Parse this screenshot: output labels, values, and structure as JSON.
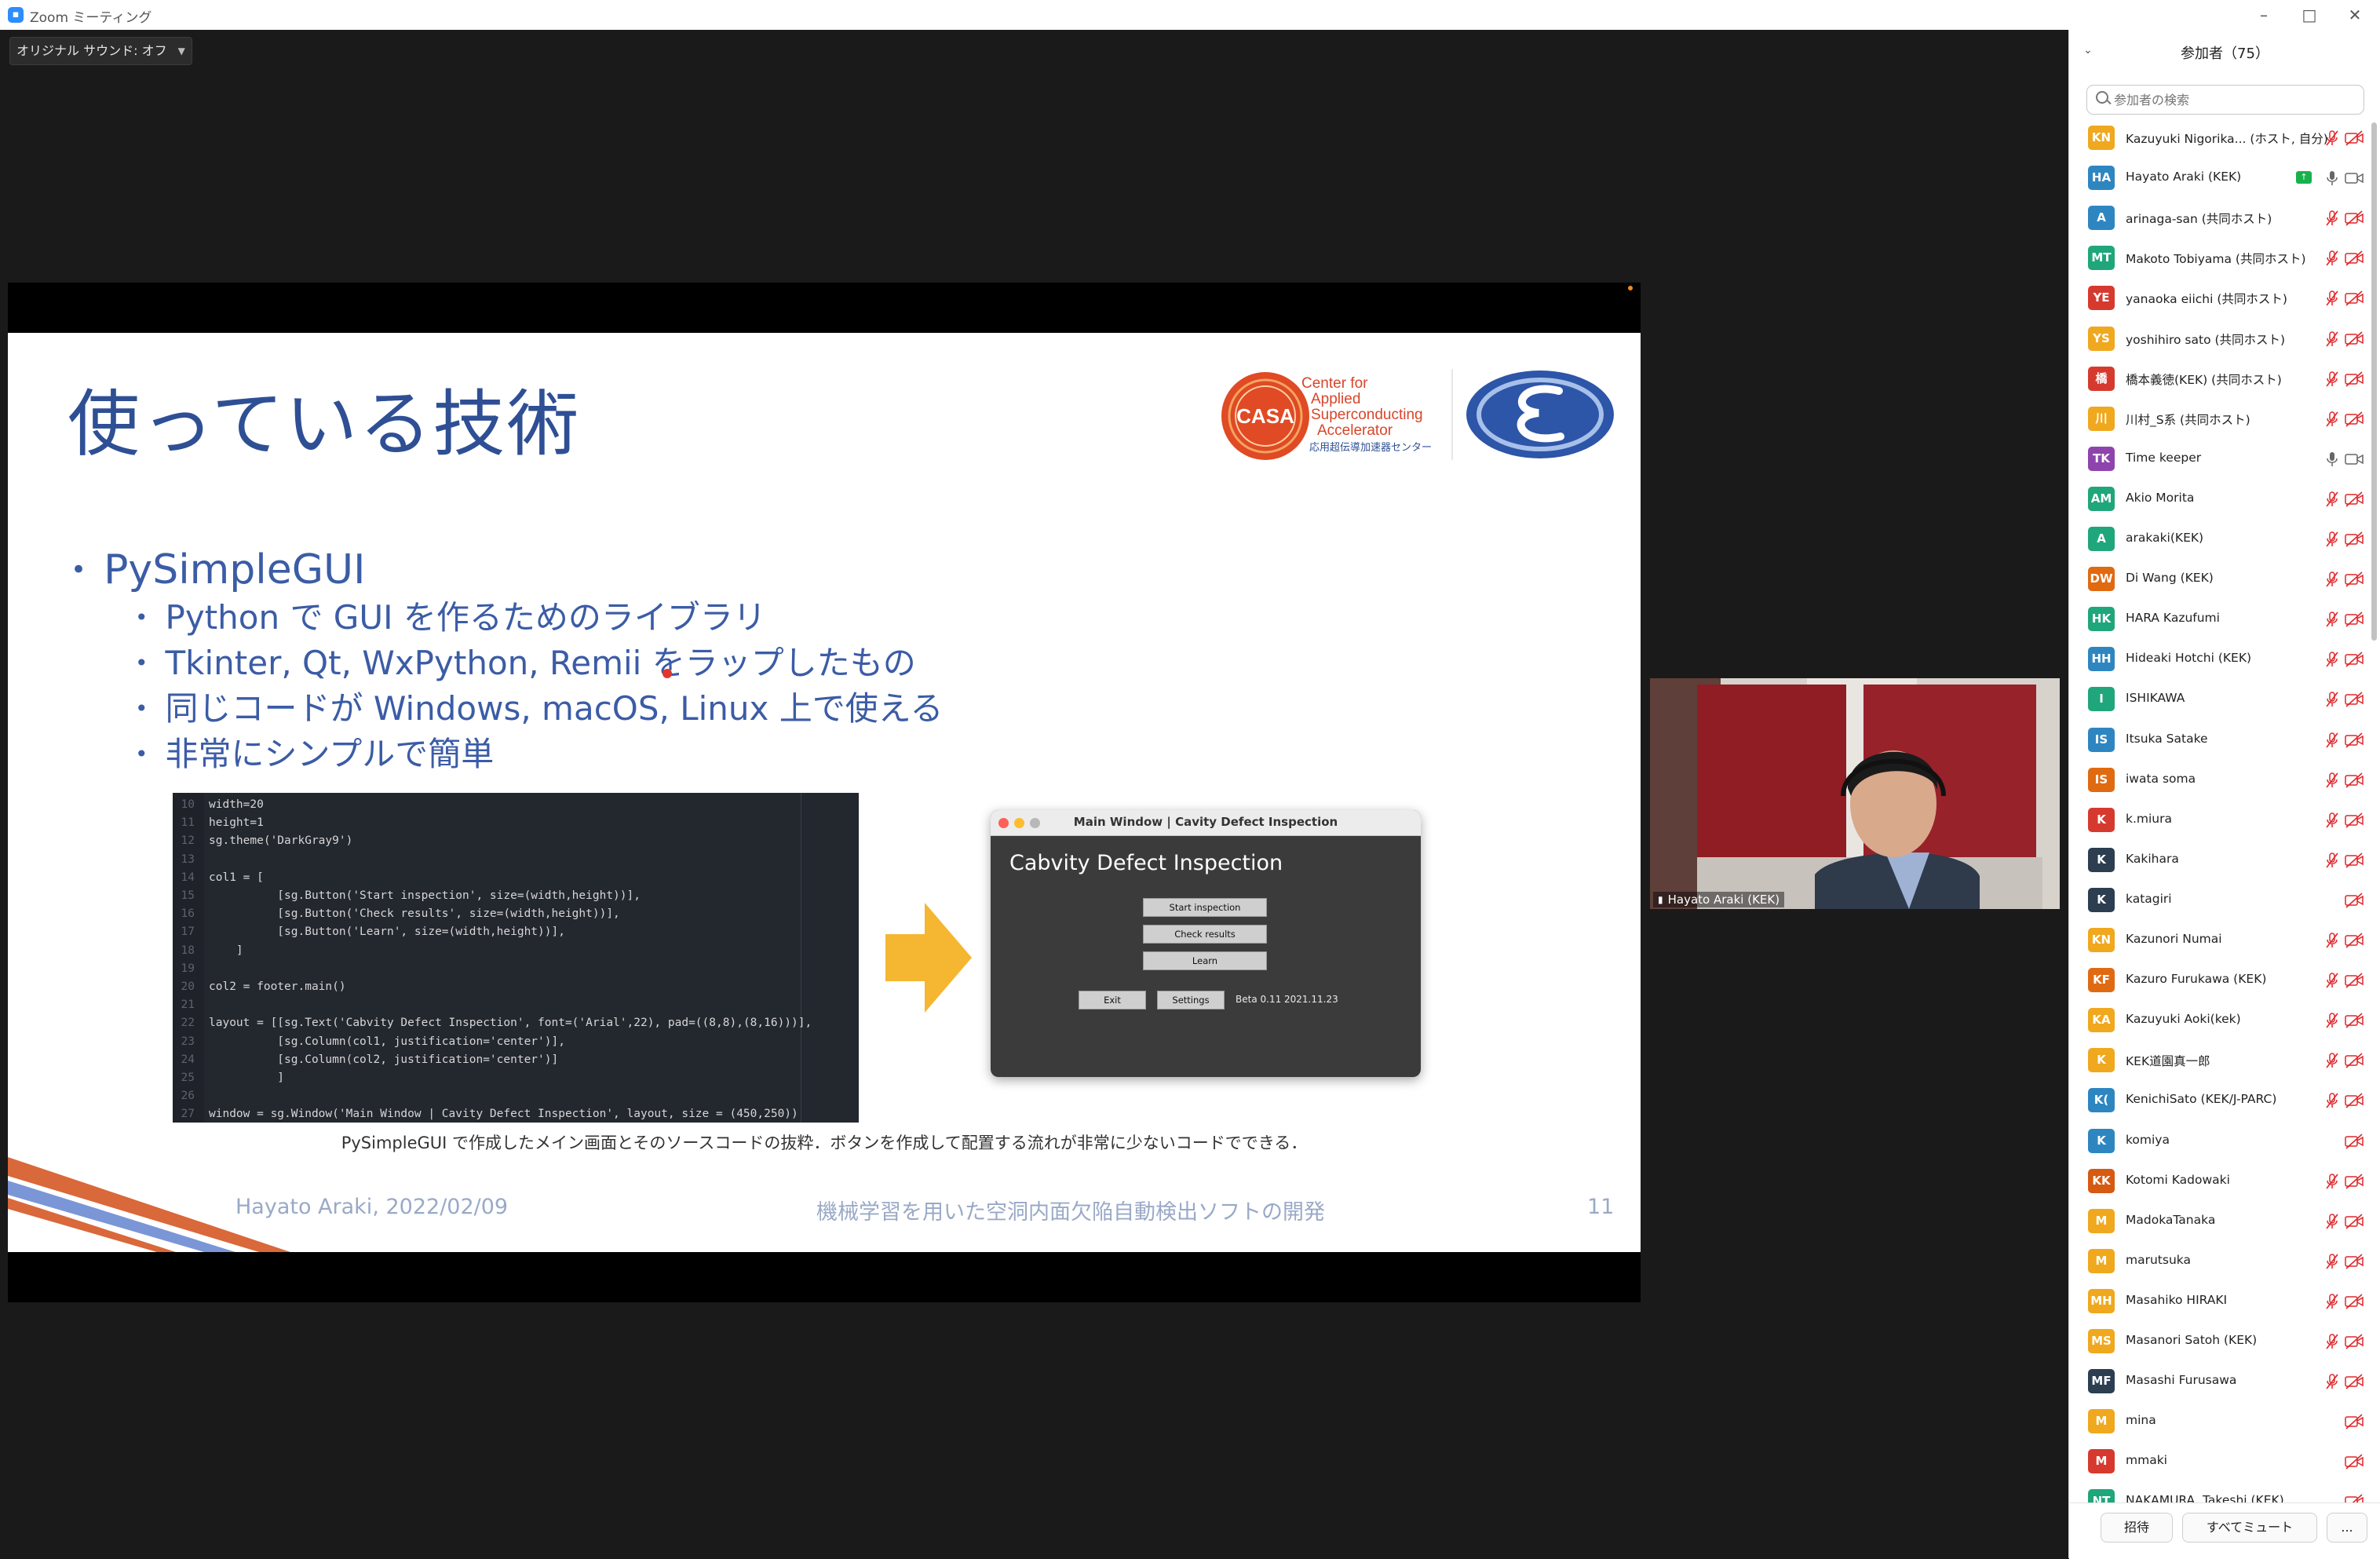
{
  "window": {
    "title": "Zoom ミーティング"
  },
  "audio_toggle": {
    "label": "オリジナル サウンド: オフ"
  },
  "slide": {
    "title": "使っている技術",
    "logo_casa_text": "CASA",
    "logo_lines": [
      "Center for",
      "Applied",
      "Superconducting",
      "Accelerator"
    ],
    "logo_jp": "応用超伝導加速器センター",
    "bullet_main": "PySimpleGUI",
    "sub_bullets": [
      "Python で GUI を作るためのライブラリ",
      "Tkinter, Qt, WxPython, Remii をラップしたもの",
      "同じコードが Windows, macOS, Linux 上で使える",
      "非常にシンプルで簡単"
    ],
    "code_lines": [
      {
        "n": "10",
        "t": "width=20"
      },
      {
        "n": "11",
        "t": "height=1"
      },
      {
        "n": "12",
        "t": "sg.theme('DarkGray9')"
      },
      {
        "n": "13",
        "t": ""
      },
      {
        "n": "14",
        "t": "col1 = ["
      },
      {
        "n": "15",
        "t": "          [sg.Button('Start inspection', size=(width,height))],"
      },
      {
        "n": "16",
        "t": "          [sg.Button('Check results', size=(width,height))],"
      },
      {
        "n": "17",
        "t": "          [sg.Button('Learn', size=(width,height))],"
      },
      {
        "n": "18",
        "t": "    ]"
      },
      {
        "n": "19",
        "t": ""
      },
      {
        "n": "20",
        "t": "col2 = footer.main()"
      },
      {
        "n": "21",
        "t": ""
      },
      {
        "n": "22",
        "t": "layout = [[sg.Text('Cabvity Defect Inspection', font=('Arial',22), pad=((8,8),(8,16)))],"
      },
      {
        "n": "23",
        "t": "          [sg.Column(col1, justification='center')],"
      },
      {
        "n": "24",
        "t": "          [sg.Column(col2, justification='center')]"
      },
      {
        "n": "25",
        "t": "          ]"
      },
      {
        "n": "26",
        "t": ""
      },
      {
        "n": "27",
        "t": "window = sg.Window('Main Window | Cavity Defect Inspection', layout, size = (450,250))"
      }
    ],
    "app_window": {
      "title": "Main Window | Cavity Defect Inspection",
      "heading": "Cabvity Defect Inspection",
      "buttons": [
        "Start inspection",
        "Check results",
        "Learn"
      ],
      "exit_label": "Exit",
      "settings_label": "Settings",
      "version": "Beta 0.11 2021.11.23"
    },
    "caption": "PySimpleGUI で作成したメイン画面とそのソースコードの抜粋．ボタンを作成して配置する流れが非常に少ないコードでできる．",
    "footer_left": "Hayato Araki, 2022/02/09",
    "footer_center": "機械学習を用いた空洞内面欠陥自動検出ソフトの開発",
    "footer_right": "11"
  },
  "webcam": {
    "name": "Hayato Araki (KEK)"
  },
  "participants": {
    "title": "参加者（75）",
    "search_placeholder": "参加者の検索",
    "items": [
      {
        "initials": "KN",
        "name": "Kazuyuki Nigorika...  (ホスト, 自分)",
        "color": "#f0a81f",
        "mic": "muted",
        "cam": "off"
      },
      {
        "initials": "HA",
        "name": "Hayato Araki (KEK)",
        "color": "#2e86c1",
        "mic": "on",
        "cam": "on",
        "sharing": true
      },
      {
        "initials": "A",
        "name": "arinaga-san (共同ホスト)",
        "color": "#2e86c1",
        "mic": "muted",
        "cam": "off"
      },
      {
        "initials": "MT",
        "name": "Makoto Tobiyama (共同ホスト)",
        "color": "#1fa67a",
        "mic": "muted",
        "cam": "off"
      },
      {
        "initials": "YE",
        "name": "yanaoka eiichi (共同ホスト)",
        "color": "#d63a2f",
        "mic": "muted",
        "cam": "off"
      },
      {
        "initials": "YS",
        "name": "yoshihiro sato (共同ホスト)",
        "color": "#f0a81f",
        "mic": "muted",
        "cam": "off"
      },
      {
        "initials": "橋",
        "name": "橋本義徳(KEK) (共同ホスト)",
        "color": "#d63a2f",
        "mic": "muted",
        "cam": "off"
      },
      {
        "initials": "川",
        "name": "川村_S系 (共同ホスト)",
        "color": "#f0a81f",
        "mic": "muted",
        "cam": "off"
      },
      {
        "initials": "TK",
        "name": "Time keeper",
        "color": "#8e44ad",
        "mic": "on",
        "cam": "on"
      },
      {
        "initials": "AM",
        "name": "Akio Morita",
        "color": "#1fa67a",
        "mic": "muted",
        "cam": "off"
      },
      {
        "initials": "A",
        "name": "arakaki(KEK)",
        "color": "#1fa67a",
        "mic": "muted",
        "cam": "off"
      },
      {
        "initials": "DW",
        "name": "Di Wang (KEK)",
        "color": "#e06a12",
        "mic": "muted",
        "cam": "off"
      },
      {
        "initials": "HK",
        "name": "HARA Kazufumi",
        "color": "#1fa67a",
        "mic": "muted",
        "cam": "off"
      },
      {
        "initials": "HH",
        "name": "Hideaki Hotchi (KEK)",
        "color": "#2e86c1",
        "mic": "muted",
        "cam": "off"
      },
      {
        "initials": "I",
        "name": "ISHIKAWA",
        "color": "#1fa67a",
        "mic": "muted",
        "cam": "off"
      },
      {
        "initials": "IS",
        "name": "Itsuka Satake",
        "color": "#2e86c1",
        "mic": "muted",
        "cam": "off"
      },
      {
        "initials": "IS",
        "name": "iwata soma",
        "color": "#e06a12",
        "mic": "muted",
        "cam": "off"
      },
      {
        "initials": "K",
        "name": "k.miura",
        "color": "#d63a2f",
        "mic": "muted",
        "cam": "off"
      },
      {
        "initials": "K",
        "name": "Kakihara",
        "color": "#2c3e50",
        "mic": "muted",
        "cam": "off"
      },
      {
        "initials": "K",
        "name": "katagiri",
        "color": "#2c3e50",
        "mic": "none",
        "cam": "off"
      },
      {
        "initials": "KN",
        "name": "Kazunori Numai",
        "color": "#f0a81f",
        "mic": "muted",
        "cam": "off"
      },
      {
        "initials": "KF",
        "name": "Kazuro Furukawa (KEK)",
        "color": "#e06a12",
        "mic": "muted",
        "cam": "off"
      },
      {
        "initials": "KA",
        "name": "Kazuyuki Aoki(kek)",
        "color": "#f0a81f",
        "mic": "muted",
        "cam": "off"
      },
      {
        "initials": "K",
        "name": "KEK道園真一郎",
        "color": "#f0a81f",
        "mic": "muted",
        "cam": "off"
      },
      {
        "initials": "K(",
        "name": "KenichiSato (KEK/J-PARC)",
        "color": "#2e86c1",
        "mic": "muted",
        "cam": "off"
      },
      {
        "initials": "K",
        "name": "komiya",
        "color": "#2e86c1",
        "mic": "none",
        "cam": "off"
      },
      {
        "initials": "KK",
        "name": "Kotomi Kadowaki",
        "color": "#d65a12",
        "mic": "muted",
        "cam": "off"
      },
      {
        "initials": "M",
        "name": "MadokaTanaka",
        "color": "#f0a81f",
        "mic": "muted",
        "cam": "off"
      },
      {
        "initials": "M",
        "name": "marutsuka",
        "color": "#f0a81f",
        "mic": "muted",
        "cam": "off"
      },
      {
        "initials": "MH",
        "name": "Masahiko HIRAKI",
        "color": "#f0a81f",
        "mic": "muted",
        "cam": "off"
      },
      {
        "initials": "MS",
        "name": "Masanori Satoh (KEK)",
        "color": "#f0a81f",
        "mic": "muted",
        "cam": "off"
      },
      {
        "initials": "MF",
        "name": "Masashi Furusawa",
        "color": "#2c3e50",
        "mic": "muted",
        "cam": "off"
      },
      {
        "initials": "M",
        "name": "mina",
        "color": "#f0a81f",
        "mic": "none",
        "cam": "off"
      },
      {
        "initials": "M",
        "name": "mmaki",
        "color": "#d63a2f",
        "mic": "none",
        "cam": "off"
      },
      {
        "initials": "NT",
        "name": "NAKAMURA, Takeshi (KEK)",
        "color": "#1fa67a",
        "mic": "none",
        "cam": "off"
      }
    ],
    "invite_label": "招待",
    "mute_all_label": "すべてミュート",
    "more_label": "..."
  }
}
